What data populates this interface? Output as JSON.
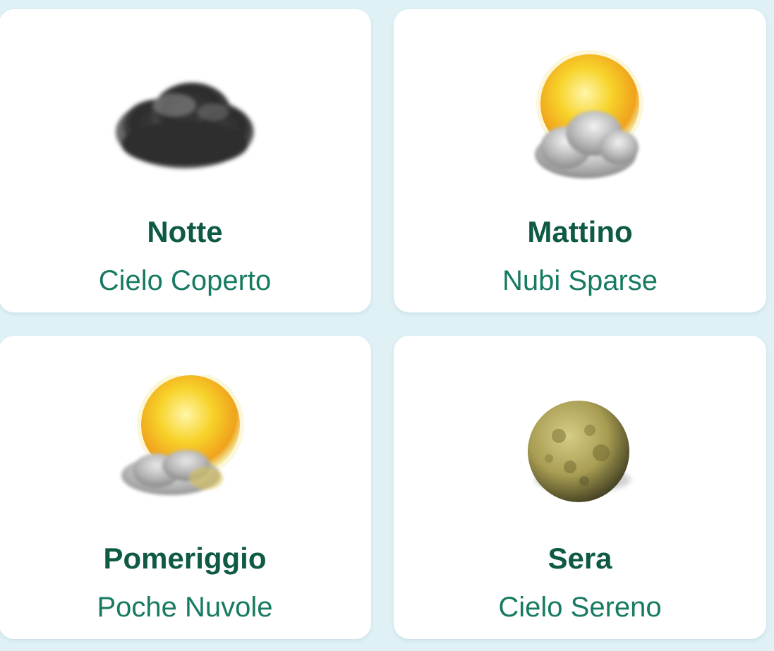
{
  "forecast": {
    "cards": [
      {
        "period": "Notte",
        "condition": "Cielo Coperto",
        "icon": "overcast-cloud-icon"
      },
      {
        "period": "Mattino",
        "condition": "Nubi Sparse",
        "icon": "sun-behind-cloud-icon"
      },
      {
        "period": "Pomeriggio",
        "condition": "Poche Nuvole",
        "icon": "sun-few-clouds-icon"
      },
      {
        "period": "Sera",
        "condition": "Cielo Sereno",
        "icon": "moon-icon"
      }
    ]
  },
  "colors": {
    "background": "#dff1f5",
    "card": "#ffffff",
    "period_text": "#0e5a44",
    "condition_text": "#177a62"
  }
}
